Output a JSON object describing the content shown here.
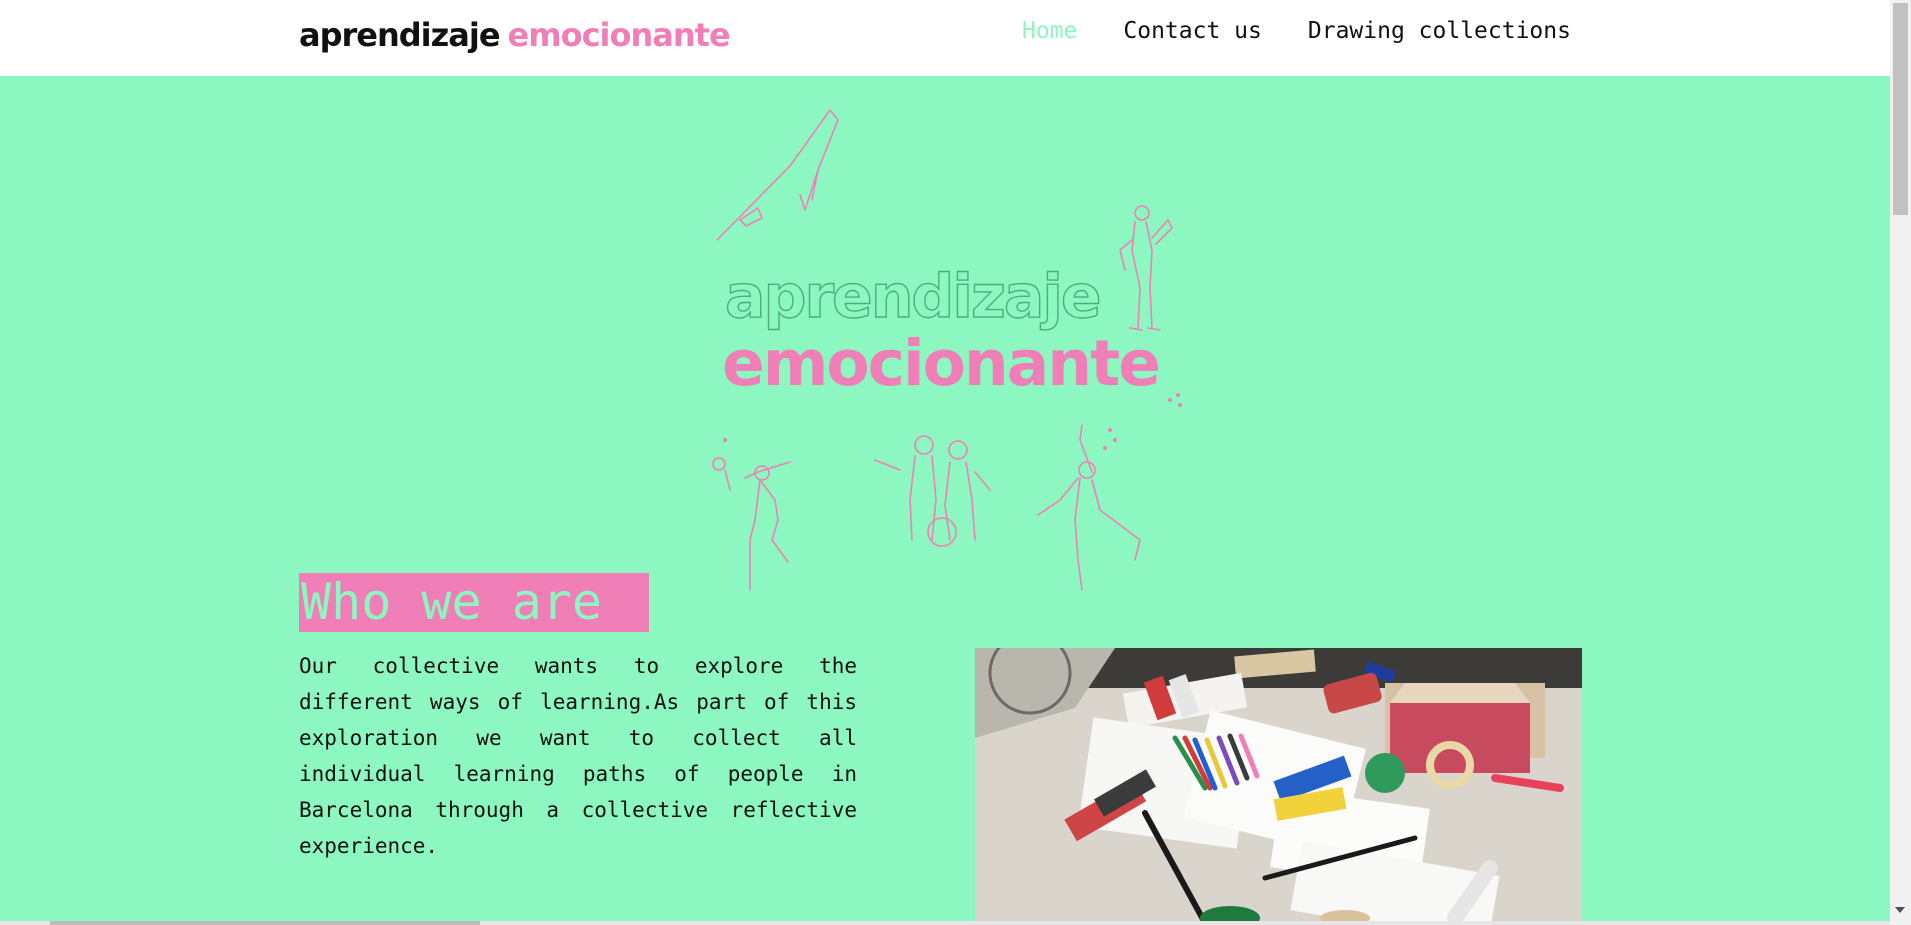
{
  "header": {
    "logo_word1": "aprendizaje",
    "logo_word2": "emocionante"
  },
  "nav": [
    {
      "label": "Home",
      "active": true
    },
    {
      "label": "Contact us",
      "active": false
    },
    {
      "label": "Drawing collections",
      "active": false
    }
  ],
  "hero": {
    "title_line1": "aprendizaje",
    "title_line2": "emocionante"
  },
  "section": {
    "heading": "Who we are",
    "body": "Our collective wants to explore the different ways of learning.As part of this exploration we want to collect all individual learning paths of people in Barcelona through a collective reflective experience."
  },
  "colors": {
    "background": "#8cf7c0",
    "accent_pink": "#f07fb8",
    "text": "#111111"
  },
  "icons": [
    "scroll-down-arrow-icon"
  ]
}
